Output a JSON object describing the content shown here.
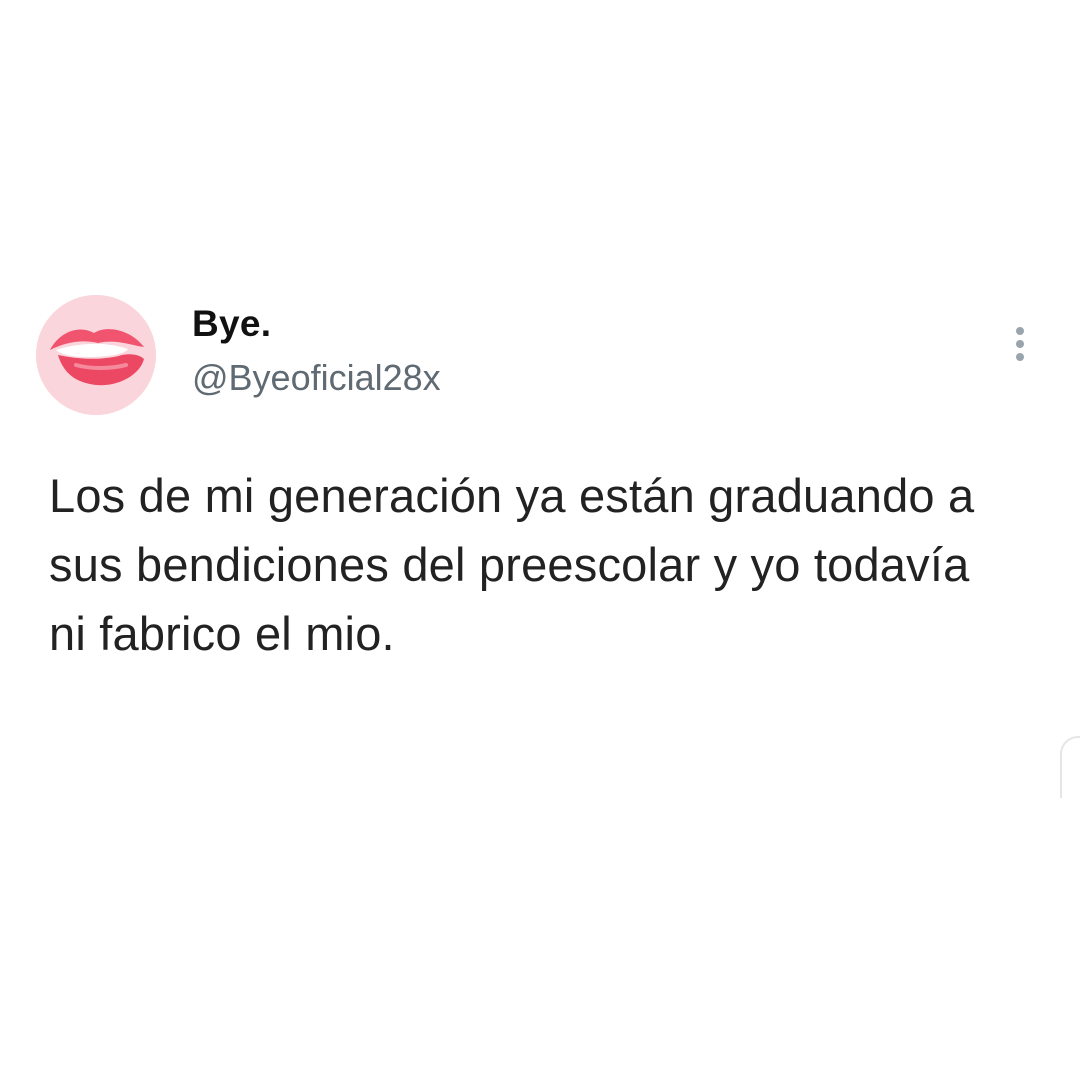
{
  "tweet": {
    "author": {
      "display_name": "Bye.",
      "handle": "@Byeoficial28x",
      "avatar_icon": "lips-icon"
    },
    "text": "Los de mi generación ya están graduando a sus bendiciones del preescolar y yo todavía ni fabrico el mio.",
    "more_icon": "more-vertical-icon"
  },
  "colors": {
    "background": "#ffffff",
    "text": "#222222",
    "handle": "#5f6a73",
    "avatar_bg": "#fbd5dc",
    "lips": "#f0546e"
  }
}
